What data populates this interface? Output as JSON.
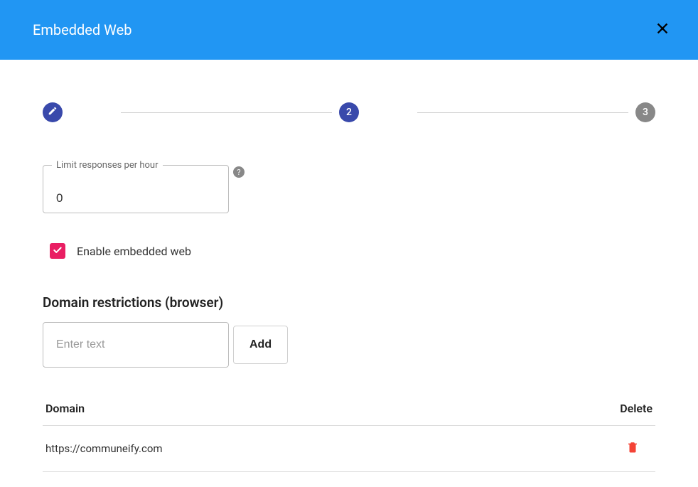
{
  "header": {
    "title": "Embedded Web"
  },
  "stepper": {
    "step2_label": "2",
    "step3_label": "3"
  },
  "limit_field": {
    "label": "Limit responses per hour",
    "value": "0"
  },
  "checkbox": {
    "label": "Enable embedded web",
    "checked": true
  },
  "domain_section": {
    "title": "Domain restrictions (browser)",
    "input_placeholder": "Enter text",
    "add_button_label": "Add"
  },
  "table": {
    "columns": {
      "domain": "Domain",
      "delete": "Delete"
    },
    "rows": [
      {
        "domain": "https://communeify.com"
      }
    ]
  },
  "colors": {
    "header_bg": "#2196f3",
    "step_active": "#3949ab",
    "step_inactive": "#888888",
    "checkbox_bg": "#e91e63",
    "delete_icon": "#f44336"
  }
}
